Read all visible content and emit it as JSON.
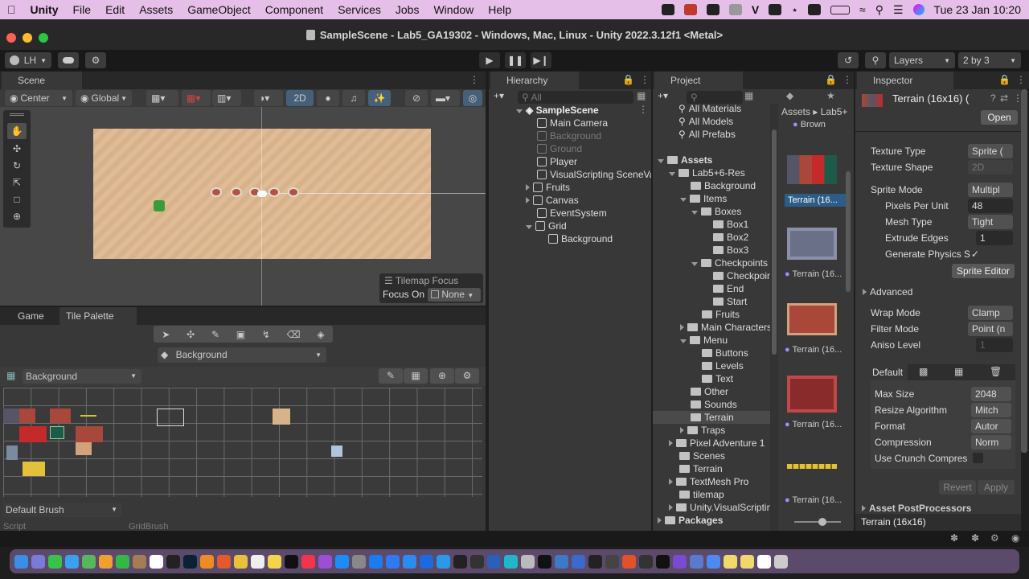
{
  "menubar": {
    "app": "Unity",
    "items": [
      "File",
      "Edit",
      "Assets",
      "GameObject",
      "Component",
      "Services",
      "Jobs",
      "Window",
      "Help"
    ],
    "clock": "Tue 23 Jan  10:20"
  },
  "window": {
    "title": "SampleScene - Lab5_GA19302 - Windows, Mac, Linux - Unity 2022.3.12f1 <Metal>"
  },
  "toolbar": {
    "account": "LH",
    "layers": "Layers",
    "layout": "2 by 3"
  },
  "scene": {
    "tab": "Scene",
    "pivot": "Center",
    "space": "Global",
    "mode2d": "2D",
    "overlay": {
      "title": "Tilemap Focus",
      "focus_label": "Focus On",
      "focus_value": "None"
    }
  },
  "palette": {
    "tab_game": "Game",
    "tab_palette": "Tile Palette",
    "active_tilemap": "Background",
    "palette_name": "Background",
    "brush": "Default Brush",
    "script_label": "Script",
    "script_value": "GridBrush"
  },
  "hierarchy": {
    "tab": "Hierarchy",
    "search_placeholder": "All",
    "scene": "SampleScene",
    "items": [
      {
        "label": "Main Camera",
        "muted": false
      },
      {
        "label": "Background",
        "muted": true
      },
      {
        "label": "Ground",
        "muted": true
      },
      {
        "label": "Player",
        "muted": false
      },
      {
        "label": "VisualScripting SceneVariables",
        "muted": false
      },
      {
        "label": "Fruits",
        "muted": false
      },
      {
        "label": "Canvas",
        "muted": false
      },
      {
        "label": "EventSystem",
        "muted": false
      },
      {
        "label": "Grid",
        "muted": false
      },
      {
        "label": "Background",
        "muted": false
      }
    ]
  },
  "project": {
    "tab": "Project",
    "favorites": [
      "All Materials",
      "All Models",
      "All Prefabs"
    ],
    "tree": [
      {
        "label": "Assets",
        "depth": 0,
        "bold": true
      },
      {
        "label": "Lab5+6-Res",
        "depth": 1
      },
      {
        "label": "Background",
        "depth": 2
      },
      {
        "label": "Items",
        "depth": 2
      },
      {
        "label": "Boxes",
        "depth": 3
      },
      {
        "label": "Box1",
        "depth": 4
      },
      {
        "label": "Box2",
        "depth": 4
      },
      {
        "label": "Box3",
        "depth": 4
      },
      {
        "label": "Checkpoints",
        "depth": 3
      },
      {
        "label": "Checkpoint",
        "depth": 4
      },
      {
        "label": "End",
        "depth": 4
      },
      {
        "label": "Start",
        "depth": 4
      },
      {
        "label": "Fruits",
        "depth": 3
      },
      {
        "label": "Main Characters",
        "depth": 2
      },
      {
        "label": "Menu",
        "depth": 2
      },
      {
        "label": "Buttons",
        "depth": 3
      },
      {
        "label": "Levels",
        "depth": 3
      },
      {
        "label": "Text",
        "depth": 3
      },
      {
        "label": "Other",
        "depth": 2
      },
      {
        "label": "Sounds",
        "depth": 2
      },
      {
        "label": "Terrain",
        "depth": 2
      },
      {
        "label": "Traps",
        "depth": 2
      },
      {
        "label": "Pixel Adventure 1",
        "depth": 1
      },
      {
        "label": "Scenes",
        "depth": 1
      },
      {
        "label": "Terrain",
        "depth": 1
      },
      {
        "label": "TextMesh Pro",
        "depth": 1
      },
      {
        "label": "tilemap",
        "depth": 1
      },
      {
        "label": "Unity.VisualScripting",
        "depth": 1
      },
      {
        "label": "Packages",
        "depth": 0,
        "bold": true
      }
    ],
    "breadcrumb": [
      "Assets",
      "Lab5+"
    ],
    "top_item": "Brown",
    "assets": [
      "Terrain (16...",
      "Terrain (16...",
      "Terrain (16...",
      "Terrain (16...",
      "Terrain (16..."
    ]
  },
  "inspector": {
    "tab": "Inspector",
    "title": "Terrain (16x16) (",
    "open": "Open",
    "texture_type_label": "Texture Type",
    "texture_type": "Sprite (",
    "texture_shape_label": "Texture Shape",
    "texture_shape": "2D",
    "sprite_mode_label": "Sprite Mode",
    "sprite_mode": "Multipl",
    "ppu_label": "Pixels Per Unit",
    "ppu": "48",
    "mesh_type_label": "Mesh Type",
    "mesh_type": "Tight",
    "extrude_label": "Extrude Edges",
    "extrude": "1",
    "gen_physics_label": "Generate Physics S",
    "sprite_editor": "Sprite Editor",
    "advanced": "Advanced",
    "wrap_label": "Wrap Mode",
    "wrap": "Clamp",
    "filter_label": "Filter Mode",
    "filter": "Point (n",
    "aniso_label": "Aniso Level",
    "aniso": "1",
    "platform_default": "Default",
    "max_size_label": "Max Size",
    "max_size": "2048",
    "resize_label": "Resize Algorithm",
    "resize": "Mitch",
    "format_label": "Format",
    "format": "Autor",
    "compression_label": "Compression",
    "compression": "Norm",
    "crunch_label": "Use Crunch Compres",
    "revert": "Revert",
    "apply": "Apply",
    "postprocessors": "Asset PostProcessors",
    "footer": "Terrain (16x16)"
  },
  "colors": {
    "accent": "#2c5d87",
    "menubar": "#e6bfe8",
    "scene_bg": "#d9b48c",
    "panel": "#383838"
  }
}
